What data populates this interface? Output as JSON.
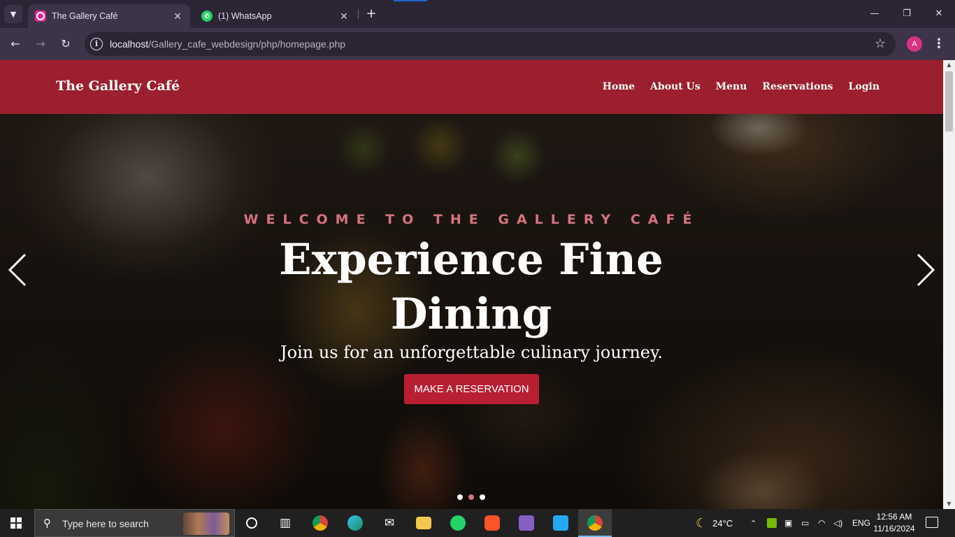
{
  "browser": {
    "tabs": [
      {
        "title": "The Gallery Café",
        "favicon": "gallery-favicon",
        "active": true
      },
      {
        "title": "(1) WhatsApp",
        "favicon": "whatsapp-favicon",
        "active": false
      }
    ],
    "url_host": "localhost",
    "url_path": "/Gallery_cafe_webdesign/php/homepage.php",
    "profile_initial": "A",
    "accent": "#d63384"
  },
  "site": {
    "brand": "The Gallery Café",
    "nav": [
      "Home",
      "About Us",
      "Menu",
      "Reservations",
      "Login"
    ],
    "header_color": "#9b1f2e"
  },
  "hero": {
    "eyebrow": "WELCOME TO THE GALLERY CAFÉ",
    "headline": "Experience Fine Dining",
    "subline": "Join us for an unforgettable culinary journey.",
    "cta": "MAKE A RESERVATION",
    "cta_color": "#b81f33",
    "slides_count": 3,
    "active_slide": 2
  },
  "taskbar": {
    "search_placeholder": "Type here to search",
    "weather": "24°C",
    "language": "ENG",
    "time": "12:56 AM",
    "date": "11/16/2024",
    "apps": [
      "task-view-icon",
      "chrome-icon",
      "edge-icon",
      "mail-icon",
      "file-explorer-icon",
      "whatsapp-icon",
      "brave-icon",
      "visual-studio-icon",
      "vscode-icon",
      "chrome-profile-icon"
    ]
  }
}
